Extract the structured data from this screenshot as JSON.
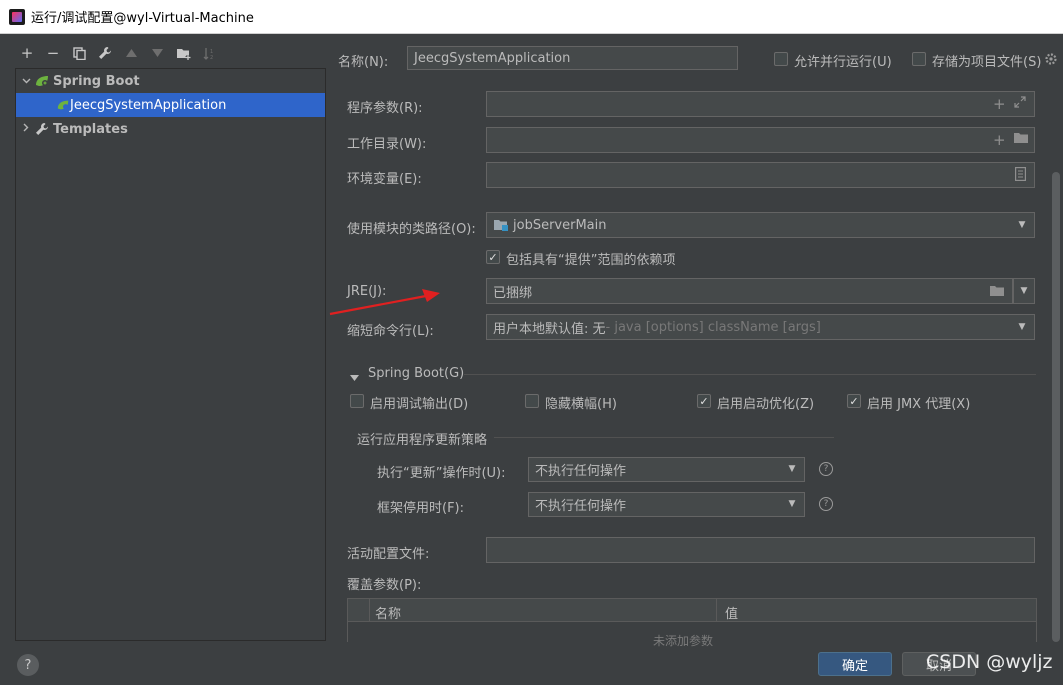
{
  "window": {
    "title": "运行/调试配置@wyl-Virtual-Machine"
  },
  "toolbar": {
    "add": "+",
    "remove": "−",
    "copy": "⧉",
    "edit": "🔧",
    "up": "▲",
    "down": "▼",
    "folder": "📁",
    "sort": "⇅"
  },
  "tree": {
    "items": [
      {
        "label": "Spring Boot",
        "expanded": true,
        "level": 0
      },
      {
        "label": "JeecgSystemApplication",
        "level": 1,
        "selected": true
      },
      {
        "label": "Templates",
        "expanded": false,
        "level": 0
      }
    ]
  },
  "header": {
    "name_label": "名称(N):",
    "name_value": "JeecgSystemApplication",
    "allow_parallel_label": "允许并行运行(U)",
    "allow_parallel_checked": false,
    "store_as_project_label": "存储为项目文件(S)",
    "store_as_project_checked": false
  },
  "form": {
    "program_args_label": "程序参数(R):",
    "program_args_value": "",
    "working_dir_label": "工作目录(W):",
    "working_dir_value": "",
    "env_vars_label": "环境变量(E):",
    "env_vars_value": "",
    "classpath_label": "使用模块的类路径(O):",
    "classpath_value": "jobServerMain",
    "include_provided_label": "包括具有“提供”范围的依赖项",
    "include_provided_checked": true,
    "jre_label": "JRE(J):",
    "jre_value": "已捆绑",
    "shorten_label": "缩短命令行(L):",
    "shorten_value": "用户本地默认值: 无",
    "shorten_hint": " - java [options] className [args]"
  },
  "springboot": {
    "section_label": "Spring Boot(G)",
    "debug_output_label": "启用调试输出(D)",
    "debug_output_checked": false,
    "hide_banner_label": "隐藏横幅(H)",
    "hide_banner_checked": false,
    "launch_opt_label": "启用启动优化(Z)",
    "launch_opt_checked": true,
    "jmx_label": "启用 JMX 代理(X)",
    "jmx_checked": true,
    "update_policy_label": "运行应用程序更新策略",
    "on_update_label": "执行“更新”操作时(U):",
    "on_update_value": "不执行任何操作",
    "on_frame_label": "框架停用时(F):",
    "on_frame_value": "不执行任何操作",
    "active_profiles_label": "活动配置文件:",
    "active_profiles_value": "",
    "override_params_label": "覆盖参数(P):",
    "table_col_name": "名称",
    "table_col_value": "值",
    "table_empty": "未添加参数"
  },
  "footer": {
    "help": "?",
    "ok_label": "确定",
    "cancel_label": "取消",
    "watermark": "CSDN @wyljz"
  },
  "colors": {
    "background": "#3c3f41",
    "selection": "#2f65ca",
    "ok_button": "#365880",
    "arrow": "#e02020"
  }
}
